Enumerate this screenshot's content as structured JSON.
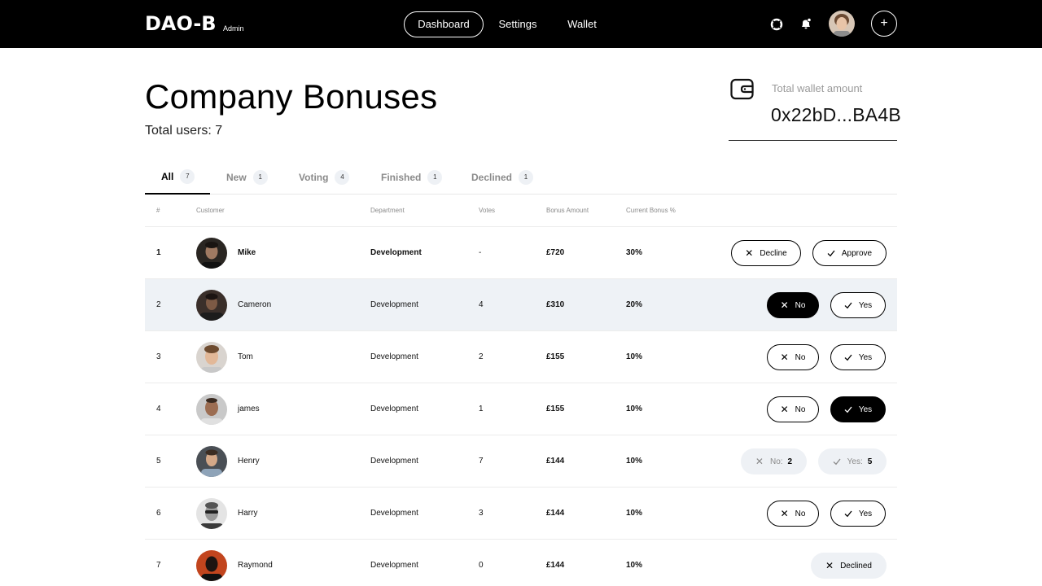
{
  "brand": {
    "logo": "DAO-B",
    "subtitle": "Admin"
  },
  "nav": {
    "items": [
      "Dashboard",
      "Settings",
      "Wallet"
    ],
    "active": "Dashboard"
  },
  "header": {
    "title": "Company Bonuses",
    "total_users": "Total users: 7"
  },
  "wallet": {
    "label": "Total wallet amount",
    "address": "0x22bD...BA4B"
  },
  "tabs": [
    {
      "label": "All",
      "count": "7"
    },
    {
      "label": "New",
      "count": "1"
    },
    {
      "label": "Voting",
      "count": "4"
    },
    {
      "label": "Finished",
      "count": "1"
    },
    {
      "label": "Declined",
      "count": "1"
    }
  ],
  "table": {
    "columns": [
      "#",
      "Customer",
      "Department",
      "Votes",
      "Bonus Amount",
      "Current Bonus %"
    ],
    "rows": [
      {
        "num": "1",
        "name": "Mike",
        "department": "Development",
        "votes": "-",
        "amount": "£720",
        "pct": "30%"
      },
      {
        "num": "2",
        "name": "Cameron",
        "department": "Development",
        "votes": "4",
        "amount": "£310",
        "pct": "20%"
      },
      {
        "num": "3",
        "name": "Tom",
        "department": "Development",
        "votes": "2",
        "amount": "£155",
        "pct": "10%"
      },
      {
        "num": "4",
        "name": "james",
        "department": "Development",
        "votes": "1",
        "amount": "£155",
        "pct": "10%"
      },
      {
        "num": "5",
        "name": "Henry",
        "department": "Development",
        "votes": "7",
        "amount": "£144",
        "pct": "10%"
      },
      {
        "num": "6",
        "name": "Harry",
        "department": "Development",
        "votes": "3",
        "amount": "£144",
        "pct": "10%"
      },
      {
        "num": "7",
        "name": "Raymond",
        "department": "Development",
        "votes": "0",
        "amount": "£144",
        "pct": "10%"
      }
    ]
  },
  "actions": {
    "decline": "Decline",
    "approve": "Approve",
    "no": "No",
    "yes": "Yes",
    "no_count_label": "No:",
    "yes_count_label": "Yes:",
    "no_count": "2",
    "yes_count": "5",
    "declined": "Declined"
  },
  "colors": {
    "topbar": "#000000",
    "highlight_row": "#eef2f6",
    "soft_button": "#eef1f5"
  }
}
